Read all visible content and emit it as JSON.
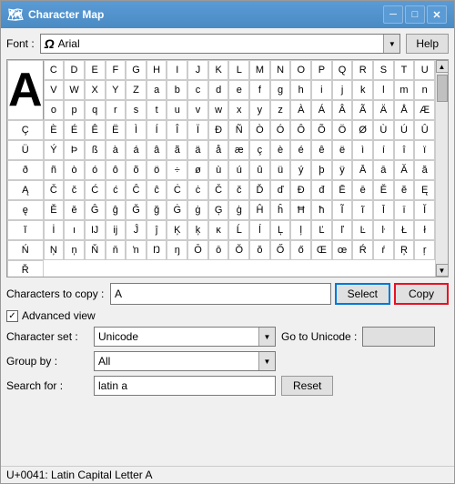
{
  "window": {
    "title": "Character Map",
    "icon": "🗺"
  },
  "titlebar": {
    "title": "Character Map",
    "minimize_label": "─",
    "maximize_label": "□",
    "close_label": "✕"
  },
  "font": {
    "label": "Font :",
    "value": "Arial",
    "icon": "A"
  },
  "help_button": "Help",
  "characters": [
    "C",
    "D",
    "E",
    "F",
    "G",
    "H",
    "I",
    "J",
    "K",
    "L",
    "M",
    "N",
    "O",
    "P",
    "Q",
    "R",
    "S",
    "T",
    "U",
    "V",
    "W",
    "X",
    "Y",
    "Z",
    "a",
    "b",
    "c",
    "d",
    "e",
    "f",
    "g",
    "h",
    "i",
    "j",
    "k",
    "l",
    "m",
    "n",
    "o",
    "p",
    "q",
    "r",
    "s",
    "t",
    "u",
    "v",
    "w",
    "x",
    "y",
    "z",
    "À",
    "Á",
    "Â",
    "Ã",
    "Ä",
    "Å",
    "Æ",
    "Ç",
    "È",
    "É",
    "Ê",
    "Ë",
    "Ì",
    "Í",
    "Î",
    "Ï",
    "Ð",
    "Ñ",
    "Ò",
    "Ó",
    "Ô",
    "Õ",
    "Ö",
    "Ø",
    "Ù",
    "Ú",
    "Û",
    "Ü",
    "Ý",
    "Þ",
    "ß",
    "à",
    "á",
    "â",
    "ã",
    "ä",
    "å",
    "æ",
    "ç",
    "è",
    "é",
    "ê",
    "ë",
    "ì",
    "í",
    "î",
    "ï",
    "ð",
    "ñ",
    "ò",
    "ó",
    "ô",
    "õ",
    "ö",
    "÷",
    "ø",
    "ù",
    "ú",
    "û",
    "ü",
    "ý",
    "þ",
    "ÿ",
    "Ā",
    "ā",
    "Ă",
    "ă",
    "Ą",
    "Č",
    "č",
    "Ć",
    "ć",
    "Ĉ",
    "ĉ",
    "Ċ",
    "ċ",
    "Č",
    "č",
    "Ď",
    "ď",
    "Đ",
    "đ",
    "Ē",
    "ē",
    "Ĕ",
    "ĕ",
    "Ę",
    "ę",
    "Ě",
    "ě",
    "Ĝ",
    "ĝ",
    "Ğ",
    "ğ",
    "Ġ",
    "ġ",
    "Ģ",
    "ģ",
    "Ĥ",
    "ĥ",
    "Ħ",
    "ħ",
    "Ĩ",
    "ĩ",
    "Ī",
    "ī",
    "Ĭ",
    "ĭ",
    "İ",
    "ı",
    "Ĳ",
    "ĳ",
    "Ĵ",
    "ĵ",
    "Ķ",
    "ķ",
    "ĸ",
    "Ĺ",
    "ĺ",
    "Ļ",
    "ļ",
    "Ľ",
    "ľ",
    "Ŀ",
    "ŀ",
    "Ł",
    "ł",
    "Ń",
    "Ņ",
    "ņ",
    "Ň",
    "ň",
    "ŉ",
    "Ŋ",
    "ŋ",
    "Ō",
    "ō",
    "Ŏ",
    "ŏ",
    "Ő",
    "ő",
    "Œ",
    "œ",
    "Ŕ",
    "ŕ",
    "Ŗ",
    "ŗ",
    "Ř"
  ],
  "copy_section": {
    "label": "Characters to copy :",
    "value": "A",
    "select_button": "Select",
    "copy_button": "Copy"
  },
  "advanced_view": {
    "label": "Advanced view",
    "checked": true
  },
  "character_set": {
    "label": "Character set :",
    "value": "Unicode",
    "goto_label": "Go to Unicode :",
    "goto_value": ""
  },
  "group_by": {
    "label": "Group by :",
    "value": "All"
  },
  "search_for": {
    "label": "Search for :",
    "value": "latin a",
    "reset_button": "Reset"
  },
  "status_bar": {
    "text": "U+0041: Latin Capital Letter A"
  }
}
